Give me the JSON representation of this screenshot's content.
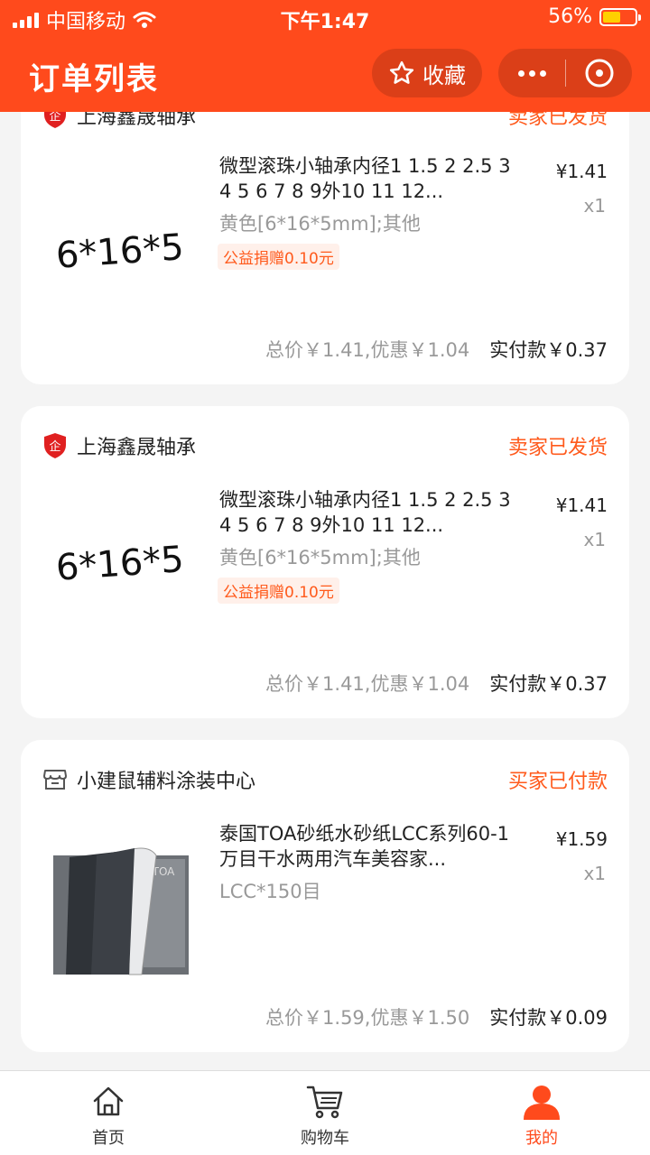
{
  "status_bar": {
    "carrier": "中国移动",
    "time": "下午1:47",
    "battery": "56%",
    "battery_level": 0.56
  },
  "header": {
    "title": "订单列表",
    "favorite_label": "收藏"
  },
  "orders": [
    {
      "shop": "上海鑫晟轴承",
      "status": "卖家已发货",
      "product_title": "微型滚珠小轴承内径1 1.5 2 2.5 3 4 5 6 7 8 9外10 11 12...",
      "spec": "黄色[6*16*5mm];其他",
      "tag": "公益捐赠0.10元",
      "thumb_text": "6*16*5",
      "price": "¥1.41",
      "qty": "x1",
      "total": "总价￥1.41,优惠￥1.04",
      "paid": "实付款￥0.37"
    },
    {
      "shop": "上海鑫晟轴承",
      "status": "卖家已发货",
      "product_title": "微型滚珠小轴承内径1 1.5 2 2.5 3 4 5 6 7 8 9外10 11 12...",
      "spec": "黄色[6*16*5mm];其他",
      "tag": "公益捐赠0.10元",
      "thumb_text": "6*16*5",
      "price": "¥1.41",
      "qty": "x1",
      "total": "总价￥1.41,优惠￥1.04",
      "paid": "实付款￥0.37"
    },
    {
      "shop": "小建鼠辅料涂装中心",
      "status": "买家已付款",
      "product_title": "泰国TOA砂纸水砂纸LCC系列60-1万目干水两用汽车美容家...",
      "spec": "LCC*150目",
      "price": "¥1.59",
      "qty": "x1",
      "total": "总价￥1.59,优惠￥1.50",
      "paid": "实付款￥0.09"
    }
  ],
  "tabbar": {
    "home": "首页",
    "cart": "购物车",
    "mine": "我的"
  },
  "colors": {
    "brand": "#ff4a1c",
    "status_text": "#ff5a1c"
  }
}
